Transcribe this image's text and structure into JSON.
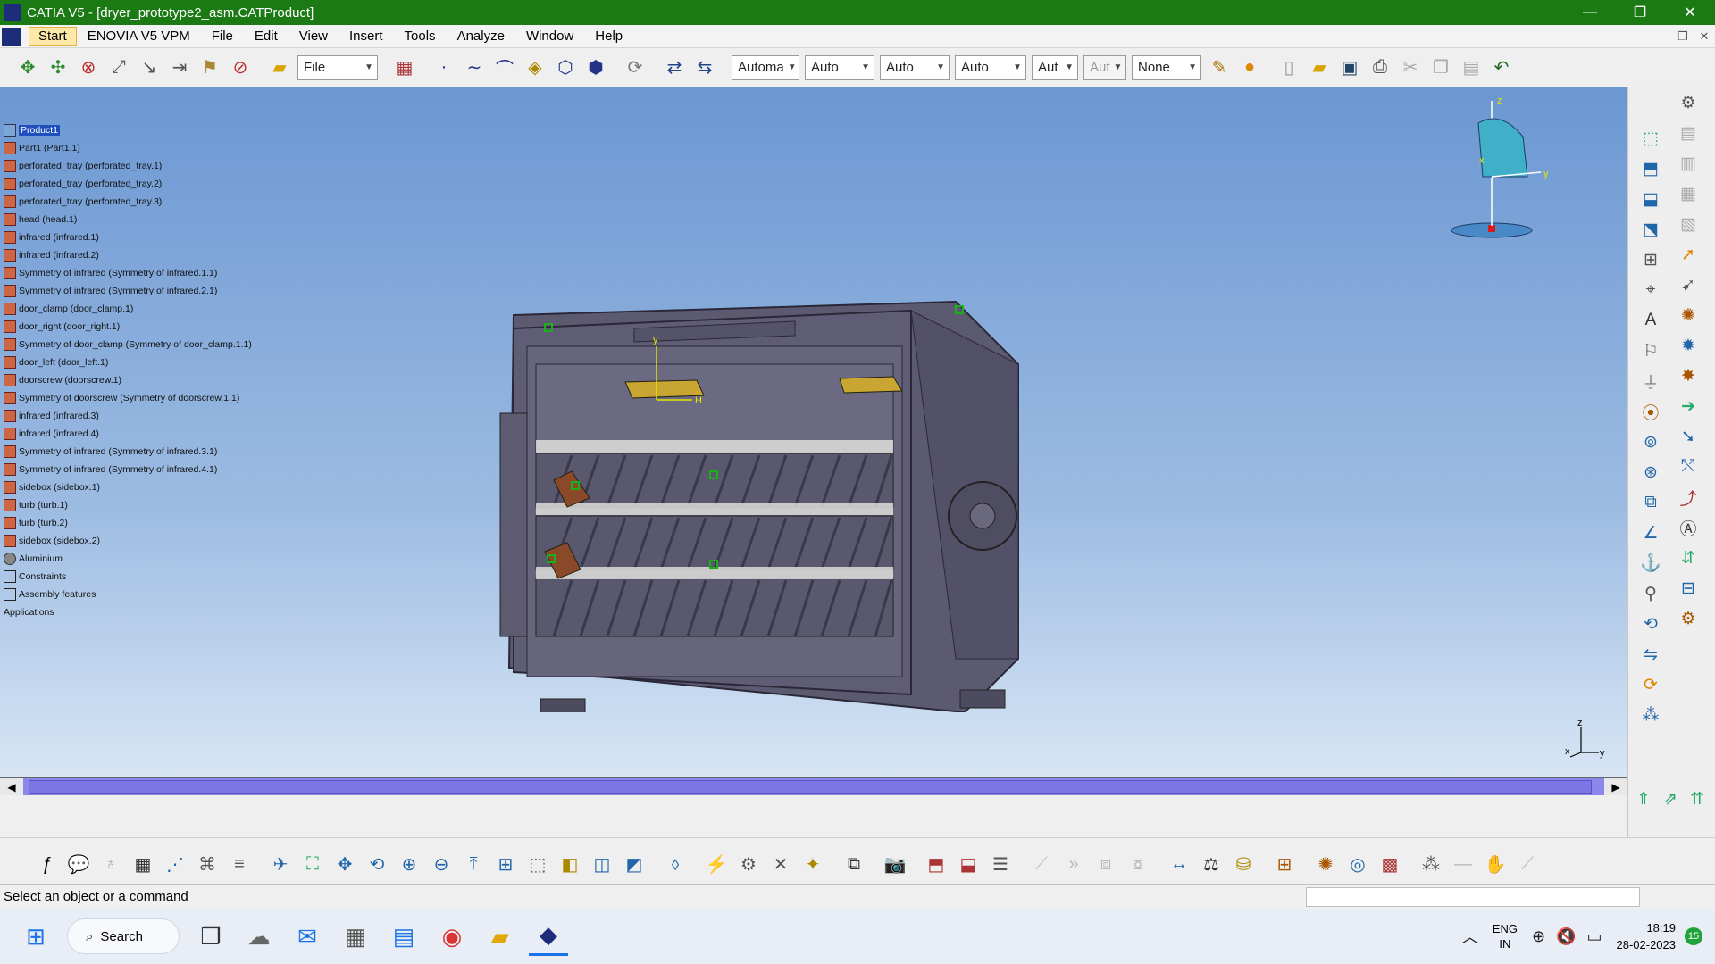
{
  "window": {
    "title": "CATIA V5 - [dryer_prototype2_asm.CATProduct]",
    "minimize": "—",
    "restore": "❐",
    "close": "✕"
  },
  "menu": {
    "items": [
      "Start",
      "ENOVIA V5 VPM",
      "File",
      "Edit",
      "View",
      "Insert",
      "Tools",
      "Analyze",
      "Window",
      "Help"
    ],
    "doc_buttons": [
      "–",
      "❐",
      "✕"
    ]
  },
  "toolbar": {
    "file_combo": "File",
    "combos": [
      "Automa",
      "Auto",
      "Auto",
      "Auto",
      "Aut",
      "Aut",
      "None"
    ]
  },
  "tree": {
    "root": "Product1",
    "nodes": [
      {
        "label": "Part1 (Part1.1)",
        "icon": "part-icon"
      },
      {
        "label": "perforated_tray (perforated_tray.1)",
        "icon": "part-icon"
      },
      {
        "label": "perforated_tray (perforated_tray.2)",
        "icon": "part-icon"
      },
      {
        "label": "perforated_tray (perforated_tray.3)",
        "icon": "part-icon"
      },
      {
        "label": "head (head.1)",
        "icon": "part-icon"
      },
      {
        "label": "infrared (infrared.1)",
        "icon": "part-icon"
      },
      {
        "label": "infrared (infrared.2)",
        "icon": "part-icon"
      },
      {
        "label": "Symmetry of infrared (Symmetry of infrared.1.1)",
        "icon": "part-icon"
      },
      {
        "label": "Symmetry of infrared (Symmetry of infrared.2.1)",
        "icon": "part-icon"
      },
      {
        "label": "door_clamp (door_clamp.1)",
        "icon": "part-icon"
      },
      {
        "label": "door_right (door_right.1)",
        "icon": "part-icon"
      },
      {
        "label": "Symmetry of door_clamp (Symmetry of door_clamp.1.1)",
        "icon": "part-icon"
      },
      {
        "label": "door_left (door_left.1)",
        "icon": "part-icon"
      },
      {
        "label": "doorscrew (doorscrew.1)",
        "icon": "part-icon"
      },
      {
        "label": "Symmetry of doorscrew (Symmetry of doorscrew.1.1)",
        "icon": "part-icon"
      },
      {
        "label": "infrared (infrared.3)",
        "icon": "part-icon"
      },
      {
        "label": "infrared (infrared.4)",
        "icon": "part-icon"
      },
      {
        "label": "Symmetry of infrared (Symmetry of infrared.3.1)",
        "icon": "part-icon"
      },
      {
        "label": "Symmetry of infrared (Symmetry of infrared.4.1)",
        "icon": "part-icon"
      },
      {
        "label": "sidebox (sidebox.1)",
        "icon": "part-icon"
      },
      {
        "label": "turb (turb.1)",
        "icon": "part-icon"
      },
      {
        "label": "turb (turb.2)",
        "icon": "part-icon"
      },
      {
        "label": "sidebox (sidebox.2)",
        "icon": "part-icon"
      },
      {
        "label": "Aluminium",
        "icon": "material-icon"
      },
      {
        "label": "Constraints",
        "icon": "constraints-icon"
      },
      {
        "label": "Assembly features",
        "icon": "assembly-features-icon"
      },
      {
        "label": "Applications",
        "icon": "none"
      }
    ]
  },
  "compass": {
    "z": "z",
    "x": "x",
    "y": "y"
  },
  "axis": {
    "z": "z",
    "x": "x",
    "y": "y"
  },
  "model_axis": {
    "y": "y",
    "h": "H"
  },
  "status": {
    "message": "Select an object or a command"
  },
  "taskbar": {
    "search": "Search",
    "lang_top": "ENG",
    "lang_bottom": "IN",
    "time": "18:19",
    "date": "28-02-2023",
    "badge": "15"
  },
  "colors": {
    "title_bar": "#1b7a14",
    "viewport_top": "#6b97d2",
    "viewport_bottom": "#d8e6f5",
    "model": "#5c5a70",
    "scrollbar": "#8c87ea"
  }
}
